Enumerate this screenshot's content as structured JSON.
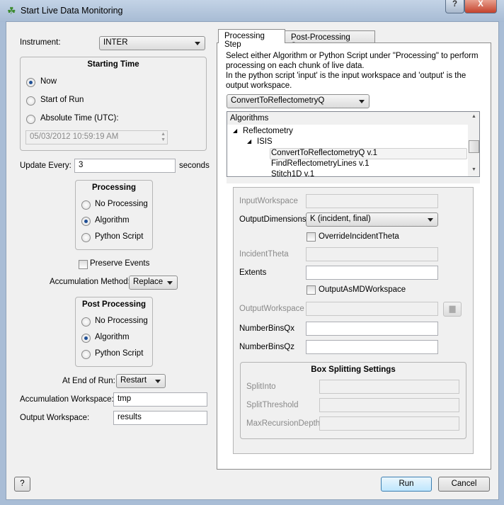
{
  "window": {
    "title": "Start Live Data Monitoring",
    "help_label": "?",
    "close_label": "X"
  },
  "left": {
    "instrument_label": "Instrument:",
    "instrument_value": "INTER",
    "starting_time": {
      "title": "Starting Time",
      "options": [
        "Now",
        "Start of Run",
        "Absolute Time (UTC):"
      ],
      "selected": 0,
      "datetime": "05/03/2012 10:59:19 AM"
    },
    "update_every_label": "Update Every:",
    "update_every_value": "3",
    "seconds_label": "seconds",
    "processing": {
      "title": "Processing",
      "options": [
        "No Processing",
        "Algorithm",
        "Python Script"
      ],
      "selected": 1
    },
    "preserve_events_label": "Preserve Events",
    "preserve_events_checked": false,
    "accumulation_method_label": "Accumulation Method:",
    "accumulation_method_value": "Replace",
    "post_processing": {
      "title": "Post Processing",
      "options": [
        "No Processing",
        "Algorithm",
        "Python Script"
      ],
      "selected": 1
    },
    "end_of_run_label": "At End of Run:",
    "end_of_run_value": "Restart",
    "accumulation_workspace_label": "Accumulation Workspace:",
    "accumulation_workspace_value": "tmp",
    "output_workspace_label": "Output Workspace:",
    "output_workspace_value": "results"
  },
  "right": {
    "tabs": [
      {
        "label": "Processing Step",
        "active": true
      },
      {
        "label": "Post-Processing Step",
        "active": false
      }
    ],
    "description": [
      "Select either Algorithm or Python Script under \"Processing\" to perform",
      "processing on each chunk of live data.",
      "In the python script 'input' is the input workspace and 'output' is the",
      "output workspace."
    ],
    "algorithm_combo": "ConvertToReflectometryQ",
    "tree": {
      "header": "Algorithms",
      "items": [
        {
          "label": "Reflectometry",
          "level": 0,
          "expanded": true
        },
        {
          "label": "ISIS",
          "level": 1,
          "expanded": true
        },
        {
          "label": "ConvertToReflectometryQ v.1",
          "level": 2,
          "selected": true
        },
        {
          "label": "FindReflectometryLines v.1",
          "level": 2
        },
        {
          "label": "Stitch1D v.1",
          "level": 2
        }
      ]
    },
    "properties": {
      "input_workspace": {
        "label": "InputWorkspace",
        "value": ""
      },
      "output_dimensions": {
        "label": "OutputDimensions",
        "value": "K (incident, final)"
      },
      "override_incident_theta": {
        "label": "OverrideIncidentTheta",
        "checked": false
      },
      "incident_theta": {
        "label": "IncidentTheta",
        "value": ""
      },
      "extents": {
        "label": "Extents",
        "value": ""
      },
      "output_as_md": {
        "label": "OutputAsMDWorkspace",
        "checked": false
      },
      "output_workspace": {
        "label": "OutputWorkspace",
        "value": ""
      },
      "bins_qx": {
        "label": "NumberBinsQx",
        "value": ""
      },
      "bins_qz": {
        "label": "NumberBinsQz",
        "value": ""
      },
      "box_splitting": {
        "title": "Box Splitting Settings",
        "split_into": "SplitInto",
        "split_threshold": "SplitThreshold",
        "max_recursion": "MaxRecursionDepth"
      }
    }
  },
  "footer": {
    "help": "?",
    "run": "Run",
    "cancel": "Cancel"
  }
}
